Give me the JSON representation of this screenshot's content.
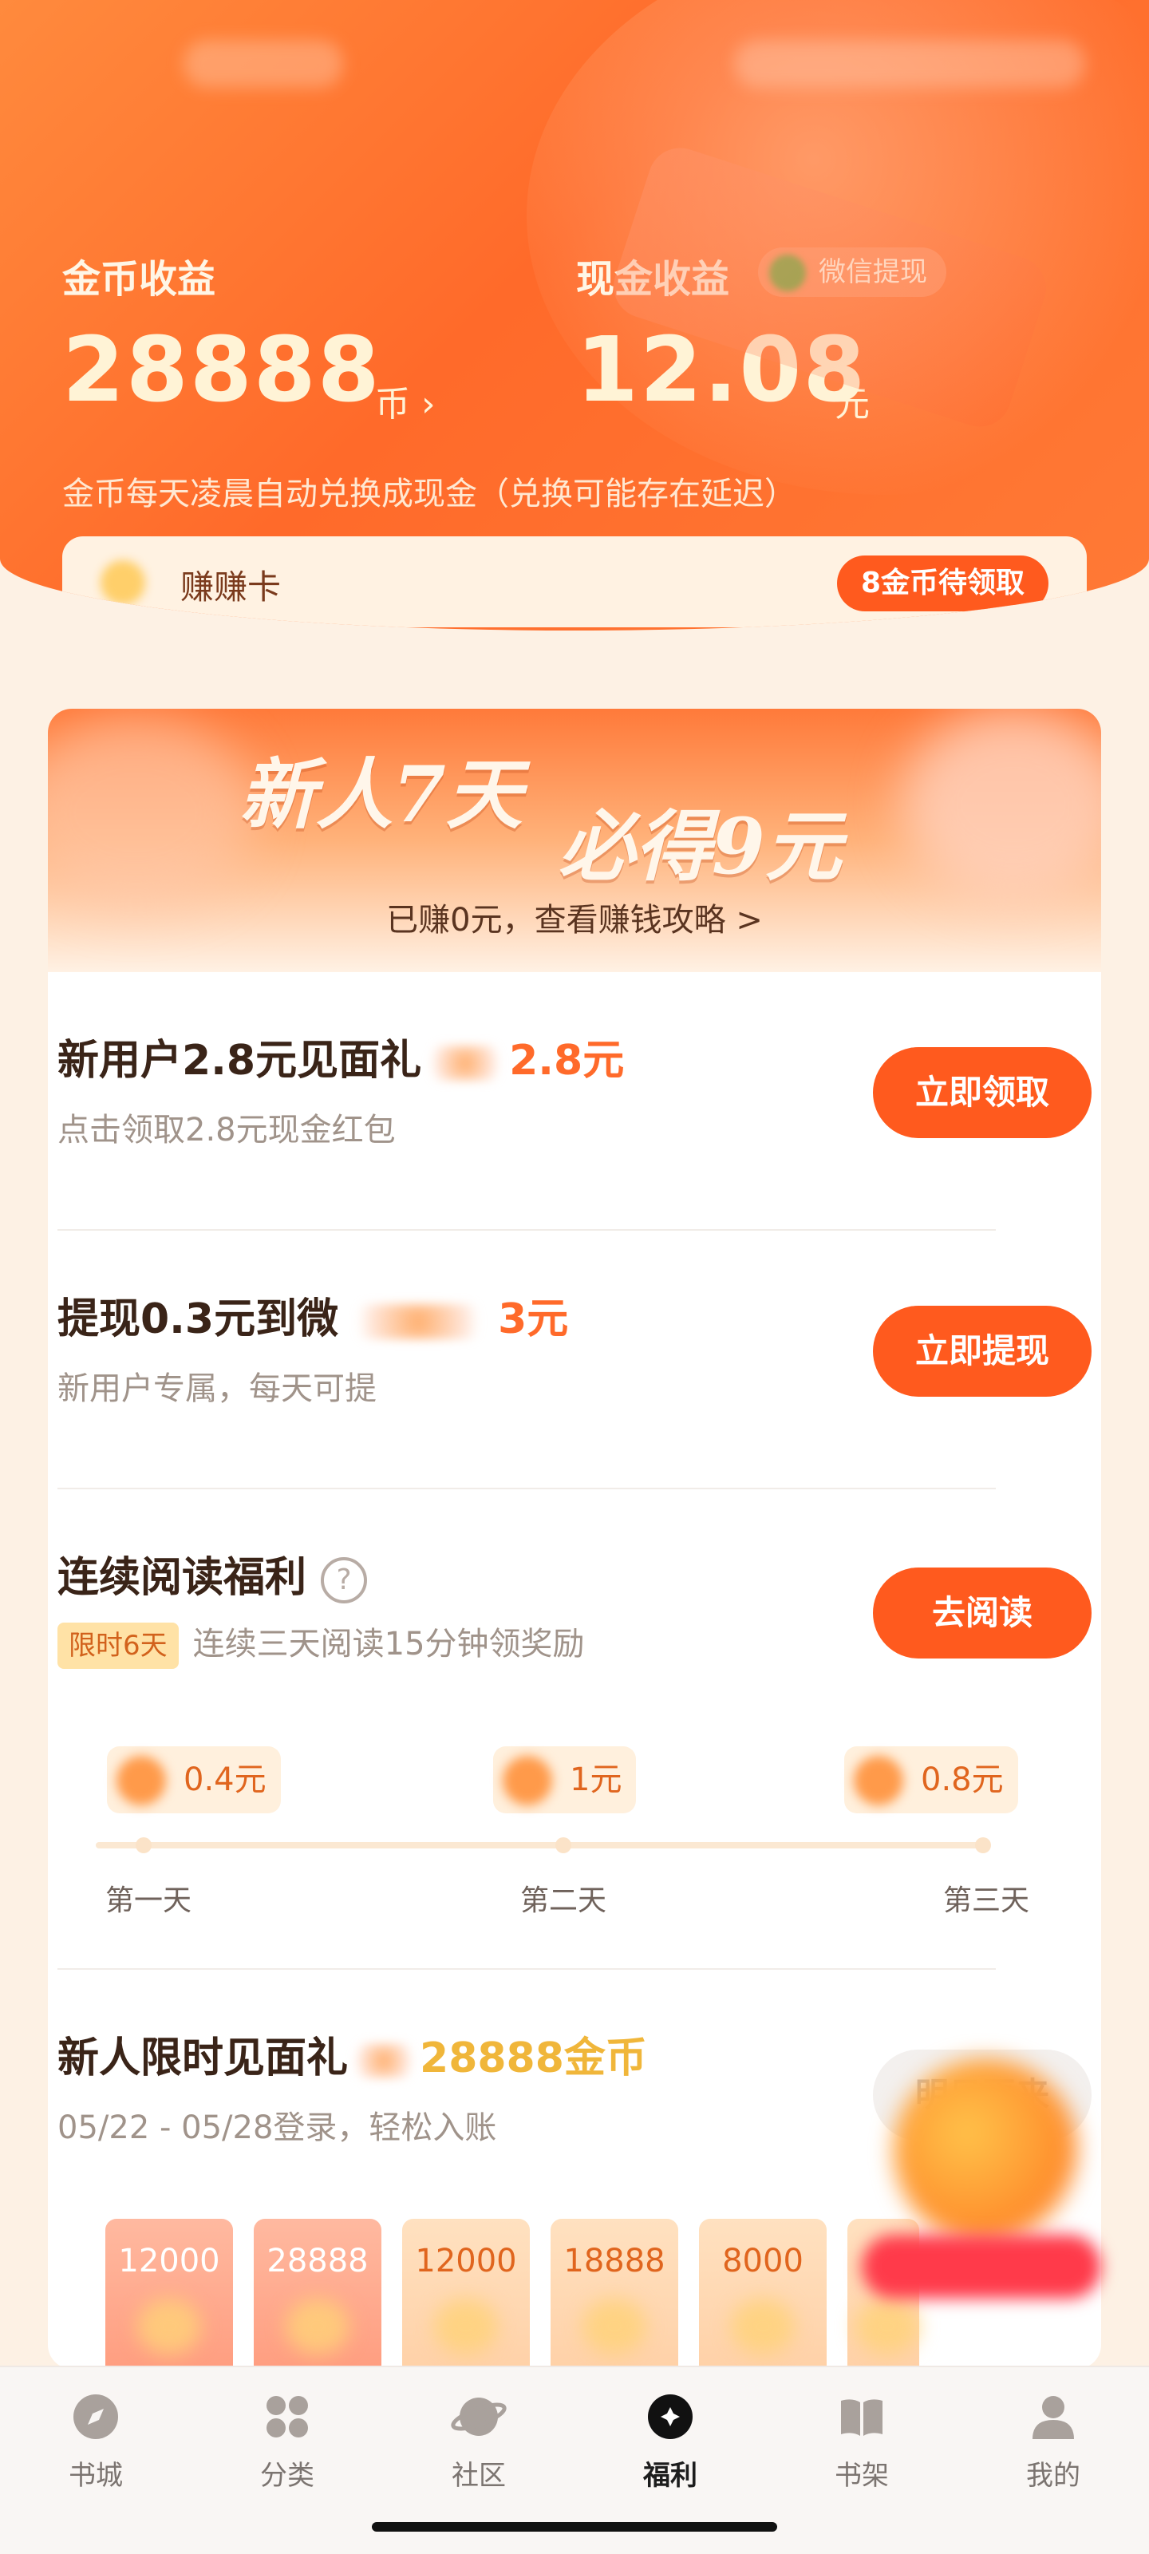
{
  "header": {
    "coin_title": "金币收益",
    "coin_value": "28888",
    "coin_unit": "币 ›",
    "cash_title": "现金收益",
    "cash_value": "12.08",
    "cash_unit": "元",
    "withdraw_label": "微信提现",
    "hint": "金币每天凌晨自动兑换成现金（兑换可能存在延迟）"
  },
  "earn_card": {
    "label": "赚赚卡",
    "pill": "8金币待领取"
  },
  "banner": {
    "title_left": "新人7天",
    "title_right": "必得9元",
    "subtitle": "已赚0元，查看赚钱攻略 >"
  },
  "tasks": [
    {
      "title": "新用户2.8元见面礼",
      "title_amount": "2.8元",
      "desc": "点击领取2.8元现金红包",
      "button": "立即领取"
    },
    {
      "title": "提现0.3元到微",
      "title_amount": "3元",
      "desc": "新用户专属，每天可提",
      "button": "立即提现"
    },
    {
      "title": "连续阅读福利",
      "tag": "限时6天",
      "desc": "连续三天阅读15分钟领奖励",
      "button": "去阅读"
    }
  ],
  "reading_days": [
    {
      "reward": "0.4元",
      "label": "第一天"
    },
    {
      "reward": "1元",
      "label": "第二天"
    },
    {
      "reward": "0.8元",
      "label": "第三天"
    }
  ],
  "gift": {
    "title": "新人限时见面礼",
    "amount": "28888金币",
    "desc": "05/22 - 05/28登录，轻松入账",
    "button": "明日再来",
    "cards": [
      "12000",
      "28888",
      "12000",
      "18888",
      "8000"
    ]
  },
  "tabbar": {
    "items": [
      {
        "label": "书城",
        "icon": "compass-icon"
      },
      {
        "label": "分类",
        "icon": "grid-icon"
      },
      {
        "label": "社区",
        "icon": "planet-icon"
      },
      {
        "label": "福利",
        "icon": "gift-icon"
      },
      {
        "label": "书架",
        "icon": "book-icon"
      },
      {
        "label": "我的",
        "icon": "user-icon"
      }
    ],
    "active": "福利"
  },
  "colors": {
    "accent": "#ff5a1e",
    "header_bg": "#ff6a2a",
    "page_bg": "#fdf1e4"
  }
}
